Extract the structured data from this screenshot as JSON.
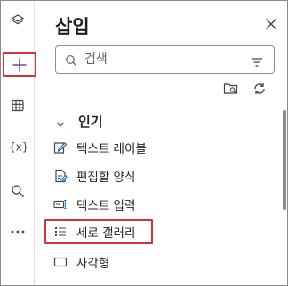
{
  "pane": {
    "title": "삽입",
    "search_placeholder": "검색"
  },
  "rail": {
    "items": [
      {
        "icon": "layers-icon"
      },
      {
        "icon": "plus-icon",
        "selected": true
      },
      {
        "icon": "table-icon"
      },
      {
        "icon": "variables-icon"
      },
      {
        "icon": "search-icon"
      },
      {
        "icon": "more-icon"
      }
    ]
  },
  "section": {
    "label": "인기"
  },
  "items": [
    {
      "label": "텍스트 레이블",
      "icon": "edit-text-icon"
    },
    {
      "label": "편집할 양식",
      "icon": "form-edit-icon"
    },
    {
      "label": "텍스트 입력",
      "icon": "text-input-icon"
    },
    {
      "label": "세로 갤러리",
      "icon": "vertical-gallery-icon"
    },
    {
      "label": "사각형",
      "icon": "rectangle-icon"
    }
  ],
  "colors": {
    "highlight": "#d13438",
    "accent": "#0f6cbd"
  }
}
